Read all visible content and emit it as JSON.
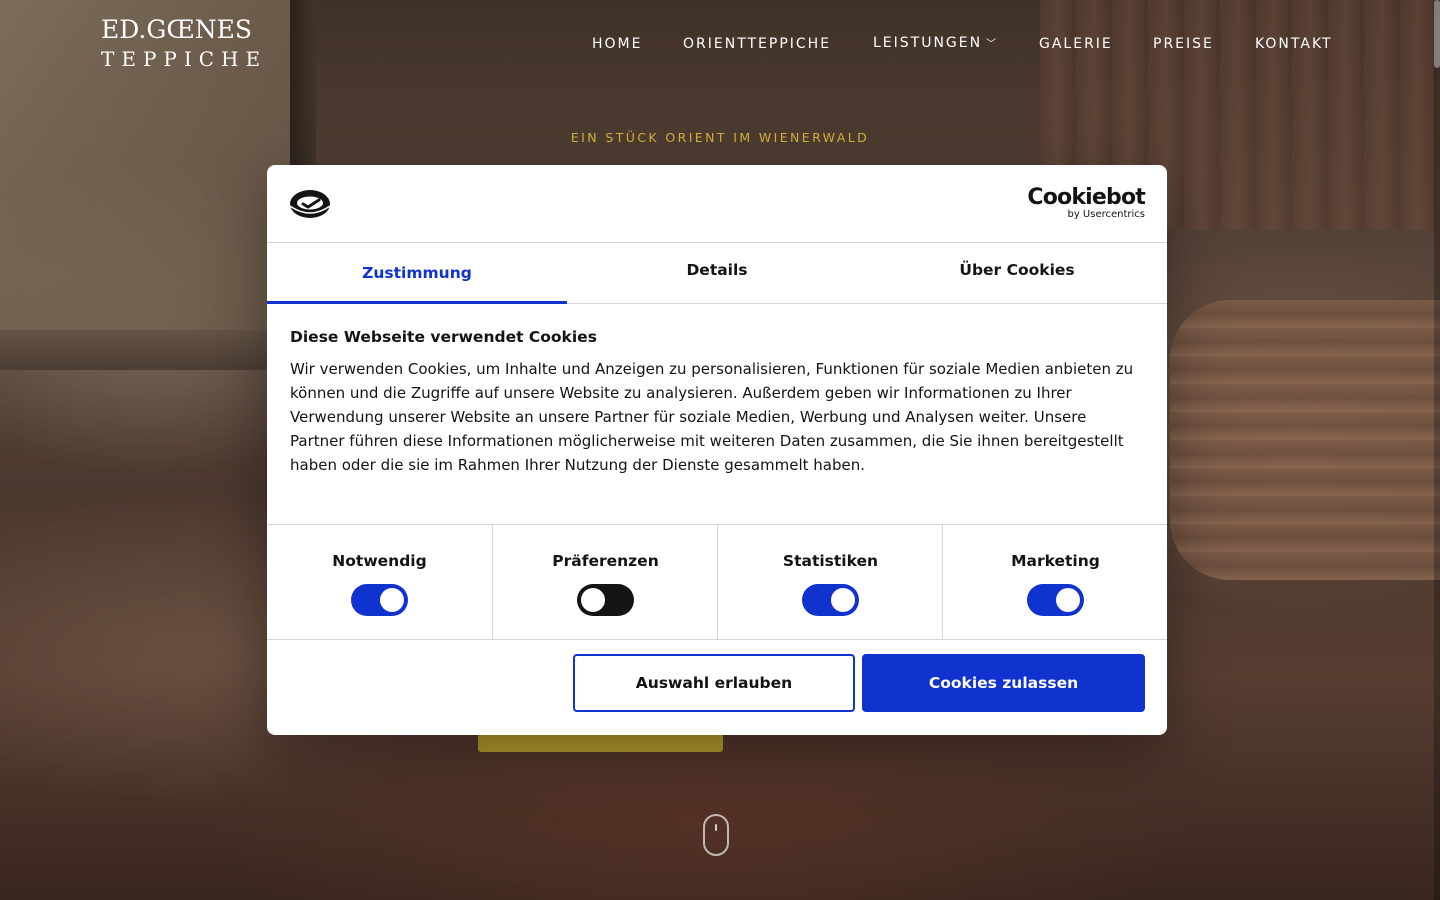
{
  "site": {
    "logo_line1": "ED.GŒNES",
    "logo_line2": "TEPPICHE",
    "nav": {
      "home": "HOME",
      "orientteppiche": "ORIENTTEPPICHE",
      "leistungen": "LEISTUNGEN",
      "galerie": "GALERIE",
      "preise": "PREISE",
      "kontakt": "KONTAKT"
    },
    "tagline": "EIN STÜCK ORIENT IM WIENERWALD"
  },
  "cookie_dialog": {
    "brand_name": "Cookiebot",
    "brand_by": "by Usercentrics",
    "tabs": {
      "consent": "Zustimmung",
      "details": "Details",
      "about": "Über Cookies"
    },
    "active_tab": "Zustimmung",
    "title": "Diese Webseite verwendet Cookies",
    "body": "Wir verwenden Cookies, um Inhalte und Anzeigen zu personalisieren, Funktionen für soziale Medien anbieten zu können und die Zugriffe auf unsere Website zu analysieren. Außerdem geben wir Informationen zu Ihrer Verwendung unserer Website an unsere Partner für soziale Medien, Werbung und Analysen weiter. Unsere Partner führen diese Informationen möglicherweise mit weiteren Daten zusammen, die Sie ihnen bereitgestellt haben oder die sie im Rahmen Ihrer Nutzung der Dienste gesammelt haben.",
    "categories": {
      "necessary": {
        "label": "Notwendig",
        "enabled": true
      },
      "preferences": {
        "label": "Präferenzen",
        "enabled": false
      },
      "statistics": {
        "label": "Statistiken",
        "enabled": true
      },
      "marketing": {
        "label": "Marketing",
        "enabled": true
      }
    },
    "buttons": {
      "allow_selection": "Auswahl erlauben",
      "allow_all": "Cookies zulassen"
    }
  },
  "colors": {
    "accent_blue": "#1032cf",
    "tagline_gold": "#d4b13a",
    "hero_button_gold": "#b39a2b"
  }
}
